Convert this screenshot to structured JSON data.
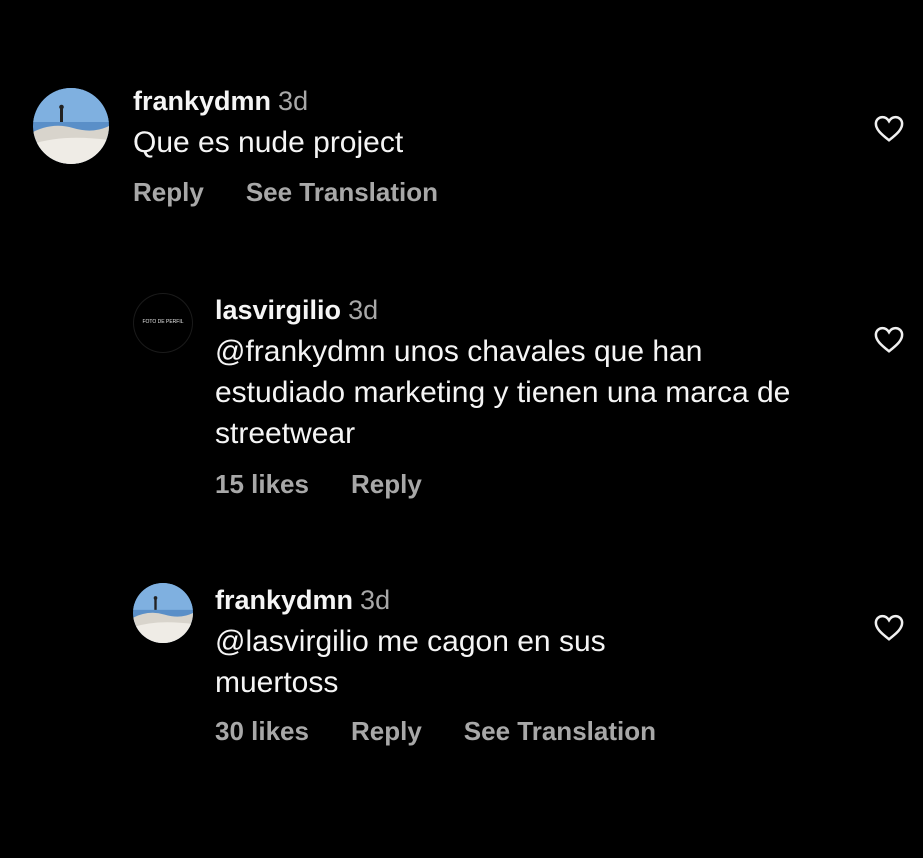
{
  "comments": [
    {
      "username": "frankydmn",
      "time": "3d",
      "text": "Que es nude project",
      "reply_label": "Reply",
      "translation_label": "See Translation",
      "avatar_icon": "beach-photo-avatar"
    },
    {
      "username": "lasvirgilio",
      "time": "3d",
      "text": "@frankydmn unos chavales que han estudiado marketing y tienen una marca de streetwear",
      "likes_label": "15 likes",
      "reply_label": "Reply",
      "avatar_text": "FOTO DE PERFIL"
    },
    {
      "username": "frankydmn",
      "time": "3d",
      "text": "@lasvirgilio me cagon en sus muertoss",
      "likes_label": "30 likes",
      "reply_label": "Reply",
      "translation_label": "See Translation",
      "avatar_icon": "beach-photo-avatar"
    }
  ],
  "icons": {
    "like": "heart-outline-icon"
  },
  "colors": {
    "background": "#000000",
    "primary_text": "#f5f5f5",
    "secondary_text": "#a8a8a8"
  }
}
